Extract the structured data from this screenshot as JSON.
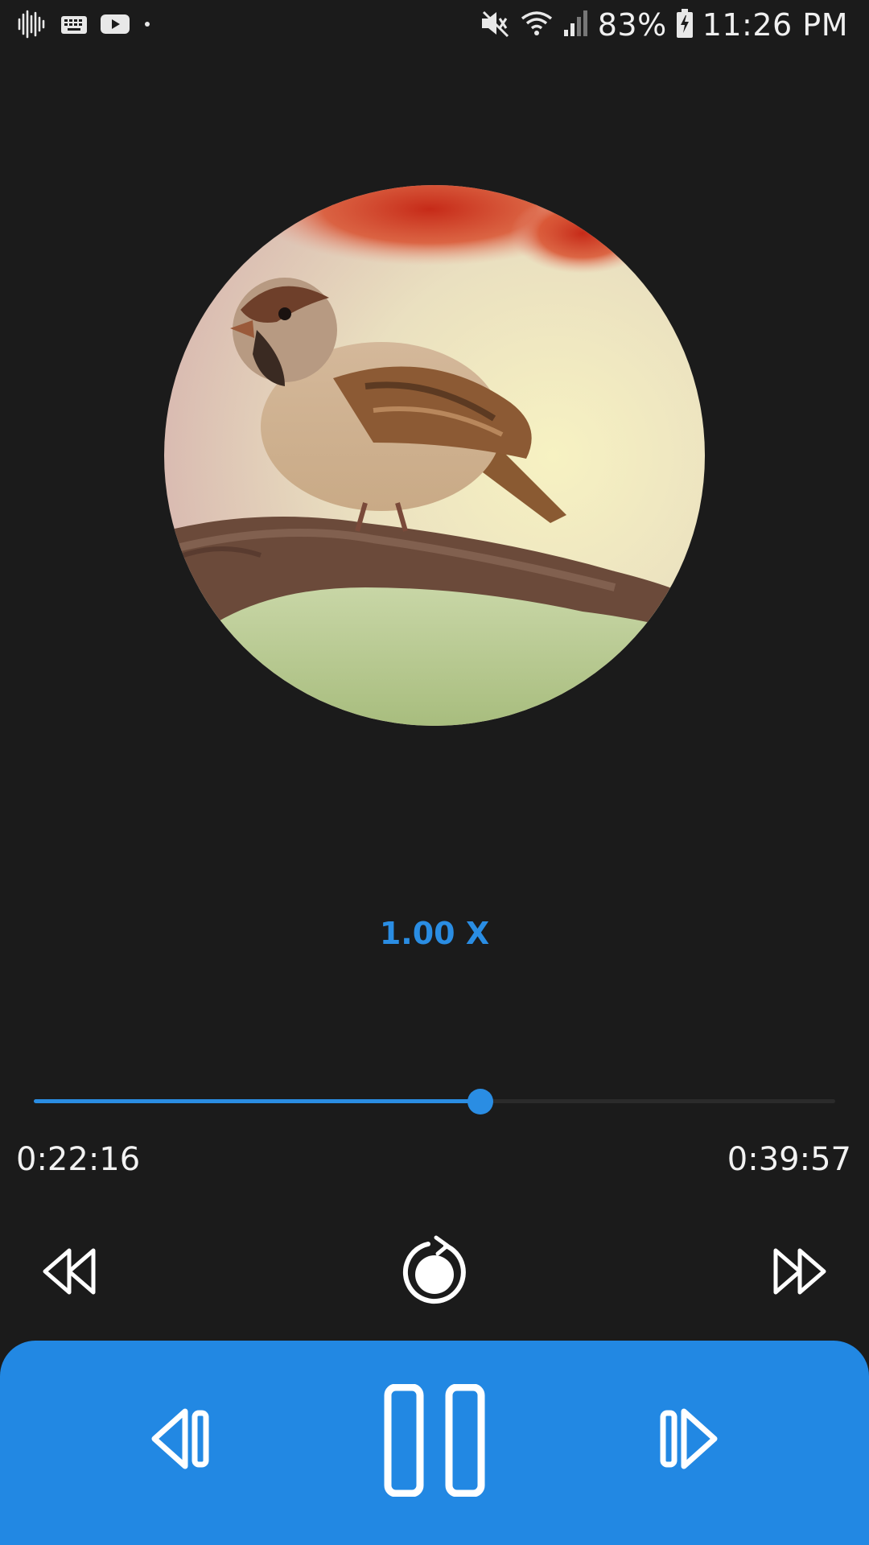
{
  "status_bar": {
    "battery": "83%",
    "time": "11:26 PM",
    "icons": [
      "audio-wave-icon",
      "keyboard-icon",
      "youtube-icon",
      "dot-icon",
      "mute-icon",
      "wifi-icon",
      "signal-icon",
      "battery-charging-icon"
    ]
  },
  "player": {
    "album_art": "sparrow-on-branch",
    "speed": "1.00 X",
    "elapsed": "0:22:16",
    "total": "0:39:57",
    "progress_fraction": 0.557
  },
  "controls": {
    "rewind": "rewind-icon",
    "repeat": "repeat-icon",
    "fast_forward": "fast-forward-icon",
    "previous": "skip-previous-icon",
    "pause": "pause-icon",
    "next": "skip-next-icon"
  },
  "colors": {
    "accent": "#2288e3",
    "background": "#1b1b1b",
    "text": "#f2f2f2"
  }
}
